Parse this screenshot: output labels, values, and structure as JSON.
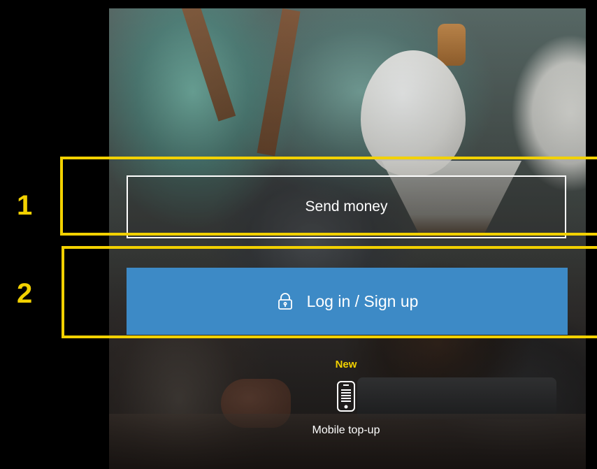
{
  "actions": {
    "send_money_label": "Send money",
    "login_label": "Log in / Sign up",
    "login_icon": "lock-icon"
  },
  "promo": {
    "badge": "New",
    "icon": "mobile-phone-icon",
    "label": "Mobile top-up"
  },
  "annotations": {
    "marker_1": "1",
    "marker_2": "2"
  },
  "colors": {
    "primary_button": "#3d8ac6",
    "annotation": "#f2d100",
    "button_text": "#ffffff",
    "background": "#000000"
  }
}
